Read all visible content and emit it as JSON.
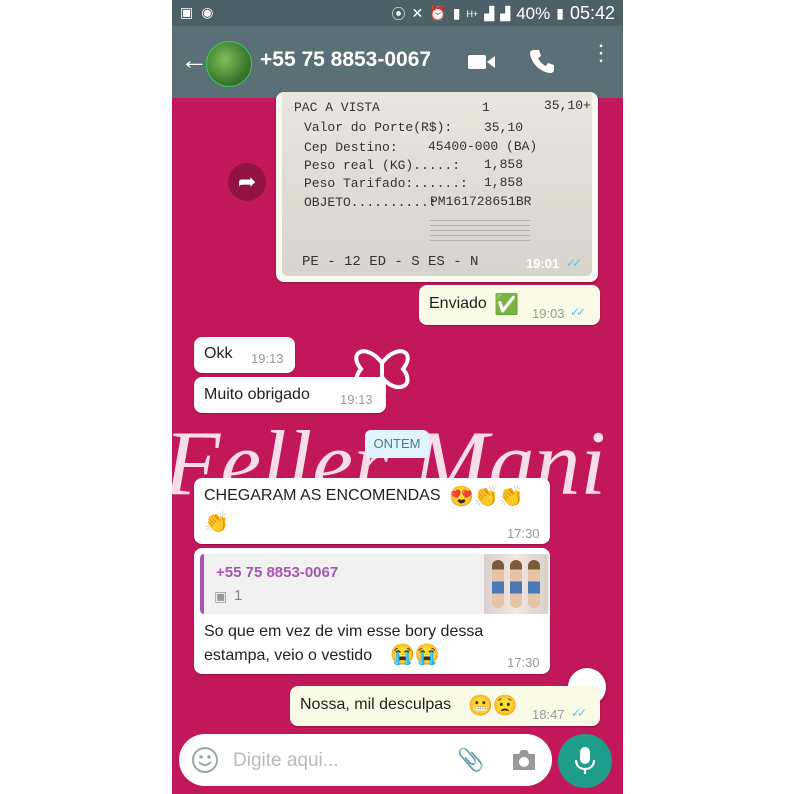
{
  "status_bar": {
    "battery": "40%",
    "time": "05:42",
    "network": "H+"
  },
  "header": {
    "contact_name": "+55 75 8853-0067"
  },
  "background": {
    "brand_text": "Feller Mani"
  },
  "receipt": {
    "lines": [
      {
        "label": "PAC A VISTA",
        "qty": "1",
        "value": "35,10+"
      },
      {
        "label": "Valor do Porte(R$):",
        "value": "35,10"
      },
      {
        "label": "Cep Destino:",
        "value": "45400-000 (BA)"
      },
      {
        "label": "Peso real (KG).....:",
        "value": "1,858"
      },
      {
        "label": "Peso Tarifado:......:",
        "value": "1,858"
      },
      {
        "label": "OBJETO..........:",
        "value": "PM161728651BR"
      }
    ],
    "footer": "PE - 12  ED - S  ES - N",
    "time": "19:01"
  },
  "messages": [
    {
      "id": "m1",
      "direction": "out",
      "text": "Enviado",
      "emoji": "✅",
      "time": "19:03"
    },
    {
      "id": "m2",
      "direction": "in",
      "text": "Okk",
      "time": "19:13"
    },
    {
      "id": "m3",
      "direction": "in",
      "text": "Muito obrigado",
      "time": "19:13"
    },
    {
      "id": "m4",
      "direction": "in",
      "text": "CHEGARAM AS ENCOMENDAS",
      "emoji": "😍👏👏👏",
      "time": "17:30"
    },
    {
      "id": "m5",
      "direction": "in",
      "quote_author": "+55 75 8853-0067",
      "quote_photo_count": "1",
      "text": "So que em vez de vim esse bory dessa estampa, veio o vestido",
      "emoji": "😭😭",
      "time": "17:30"
    },
    {
      "id": "m6",
      "direction": "out",
      "text": "Nossa, mil desculpas",
      "emoji": "😬😟",
      "time": "18:47"
    }
  ],
  "date_divider": "ONTEM",
  "composer": {
    "placeholder": "Digite aqui..."
  },
  "colors": {
    "chat_background": "#c2185b",
    "app_bar": "#5a6f76",
    "outgoing_bubble": "#dcf8c6",
    "read_ticks": "#4fc3f7",
    "mic_button": "#1e9d8b"
  }
}
